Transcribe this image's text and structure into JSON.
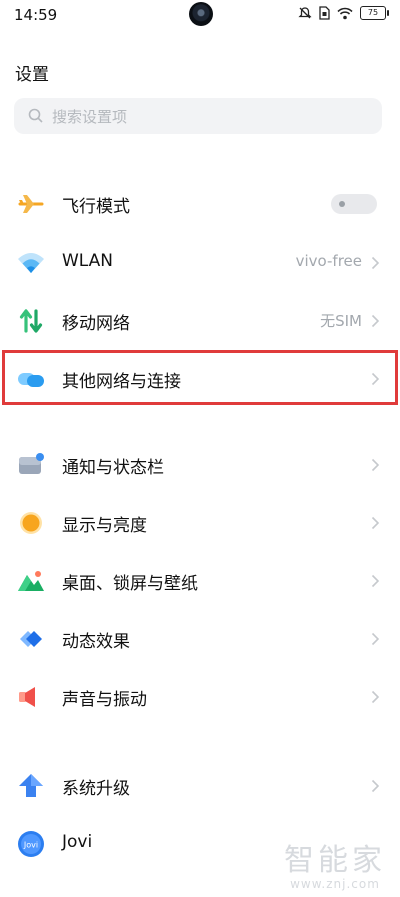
{
  "status_bar": {
    "time": "14:59",
    "battery": "75",
    "icons": [
      "mute-icon",
      "sim-icon",
      "wifi-icon",
      "battery-icon"
    ]
  },
  "header": {
    "title": "设置"
  },
  "search": {
    "placeholder": "搜索设置项"
  },
  "settings": [
    {
      "label": "飞行模式",
      "icon": "airplane-icon",
      "control": "toggle",
      "toggle_on": false
    },
    {
      "label": "WLAN",
      "icon": "wifi-icon",
      "value": "vivo-free"
    },
    {
      "label": "移动网络",
      "icon": "mobile-data-icon",
      "value": "无SIM"
    },
    {
      "label": "其他网络与连接",
      "icon": "connection-icon",
      "highlighted": true
    },
    {
      "label": "通知与状态栏",
      "icon": "notification-icon"
    },
    {
      "label": "显示与亮度",
      "icon": "brightness-icon"
    },
    {
      "label": "桌面、锁屏与壁纸",
      "icon": "wallpaper-icon"
    },
    {
      "label": "动态效果",
      "icon": "animation-icon"
    },
    {
      "label": "声音与振动",
      "icon": "sound-icon"
    },
    {
      "label": "系统升级",
      "icon": "upgrade-icon"
    },
    {
      "label": "Jovi",
      "icon": "jovi-icon",
      "icon_text": "Jovi"
    }
  ],
  "watermark": {
    "big": "智能家",
    "small": "www.znj.com"
  },
  "colors": {
    "highlight_border": "#e03b3b",
    "chevron": "#c6c9cd",
    "value_text": "#a3a8ae"
  }
}
